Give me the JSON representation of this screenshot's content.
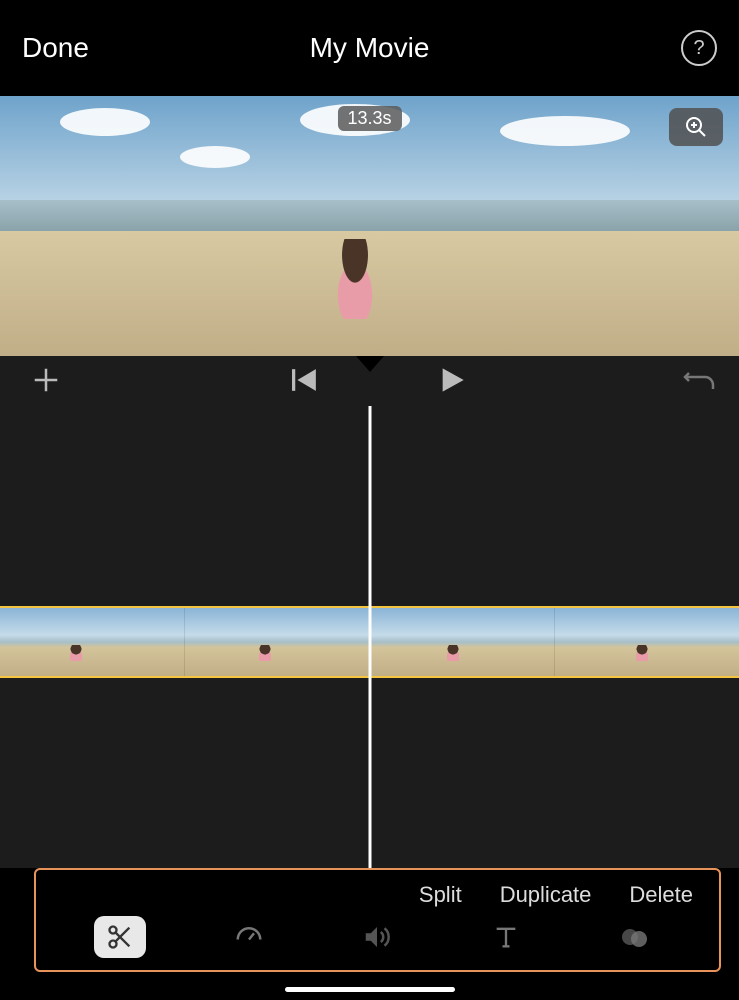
{
  "header": {
    "done_label": "Done",
    "title": "My Movie"
  },
  "preview": {
    "duration_badge": "13.3s"
  },
  "toolbar": {
    "actions": {
      "split": "Split",
      "duplicate": "Duplicate",
      "delete": "Delete"
    },
    "tabs": {
      "active": "scissors",
      "items": [
        "scissors",
        "speed",
        "volume",
        "text",
        "filters"
      ]
    }
  },
  "timeline": {
    "clip_count": 4,
    "selected": true
  }
}
